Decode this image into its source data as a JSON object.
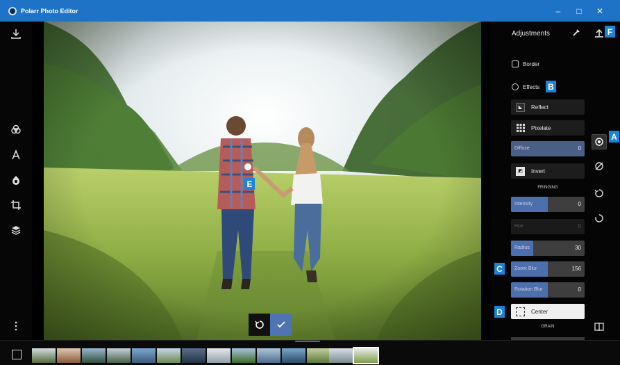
{
  "window": {
    "title": "Polarr Photo Editor",
    "minimize_glyph": "–",
    "maximize_glyph": "□",
    "close_glyph": "✕"
  },
  "left_rail": {
    "icons": [
      "download-icon",
      "filters-icon",
      "text-icon",
      "retouch-icon",
      "crop-icon",
      "layers-icon",
      "more-icon"
    ]
  },
  "panel": {
    "title": "Adjustments",
    "sections": {
      "border": "Border",
      "effects": "Effects"
    },
    "reflect": "Reflect",
    "pixelate": "Pixelate",
    "diffuse": {
      "label": "Diffuse",
      "value": "0"
    },
    "invert": "Invert",
    "fringing_head": "FRINGING",
    "intensity": {
      "label": "Intensity",
      "value": "0",
      "fill": 0.5
    },
    "hue": {
      "label": "Hue",
      "value": "0"
    },
    "radius": {
      "label": "Radius",
      "value": "30",
      "fill": 0.3
    },
    "zoom_blur": {
      "label": "Zoom Blur",
      "value": "156",
      "fill": 0.5
    },
    "rotation_blur": {
      "label": "Rotation Blur",
      "value": "0",
      "fill": 0.5
    },
    "center": "Center",
    "grain_head": "GRAIN"
  },
  "callouts": {
    "a": "A",
    "b": "B",
    "c": "C",
    "d": "D",
    "e": "E",
    "f": "F"
  },
  "colors": {
    "titlebar": "#1f73c6",
    "accent": "#4e6fae",
    "callout": "#1a84d9"
  }
}
